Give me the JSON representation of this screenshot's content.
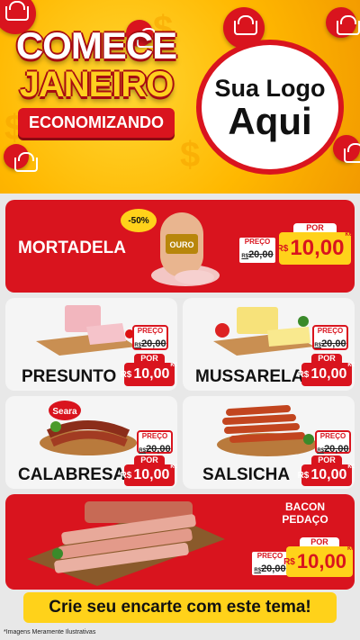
{
  "hero": {
    "title_line1": "COMECE",
    "title_line2": "JANEIRO",
    "title_line3": "ECONOMIZANDO",
    "logo_line1": "Sua Logo",
    "logo_line2": "Aqui"
  },
  "labels": {
    "old_price_label": "PREÇO",
    "new_price_label": "POR",
    "currency": "R$",
    "unit": "KG"
  },
  "products": [
    {
      "name": "MORTADELA",
      "discount": "-50%",
      "old_price": "20,00",
      "old_prefix": "R$",
      "price": "10,00"
    },
    {
      "name": "PRESUNTO",
      "old_price": "20,00",
      "old_prefix": "R$",
      "price": "10,00"
    },
    {
      "name": "MUSSARELA",
      "old_price": "20,00",
      "old_prefix": "R$",
      "price": "10,00"
    },
    {
      "name": "CALABRESA",
      "brand": "Seara",
      "old_price": "20,00",
      "old_prefix": "R$",
      "price": "10,00"
    },
    {
      "name": "SALSICHA",
      "old_price": "20,00",
      "old_prefix": "R$",
      "price": "10,00"
    },
    {
      "name_line1": "BACON",
      "name_line2": "PEDAÇO",
      "old_price": "20,00",
      "old_prefix": "R$",
      "price": "10,00"
    }
  ],
  "mortadela_brand": "OURO",
  "cta": "Crie seu encarte com este tema!",
  "disclaimer": "*Imagens Meramente Ilustrativas",
  "colors": {
    "red": "#d9141e",
    "yellow": "#ffd21a",
    "orange": "#ffb800"
  }
}
